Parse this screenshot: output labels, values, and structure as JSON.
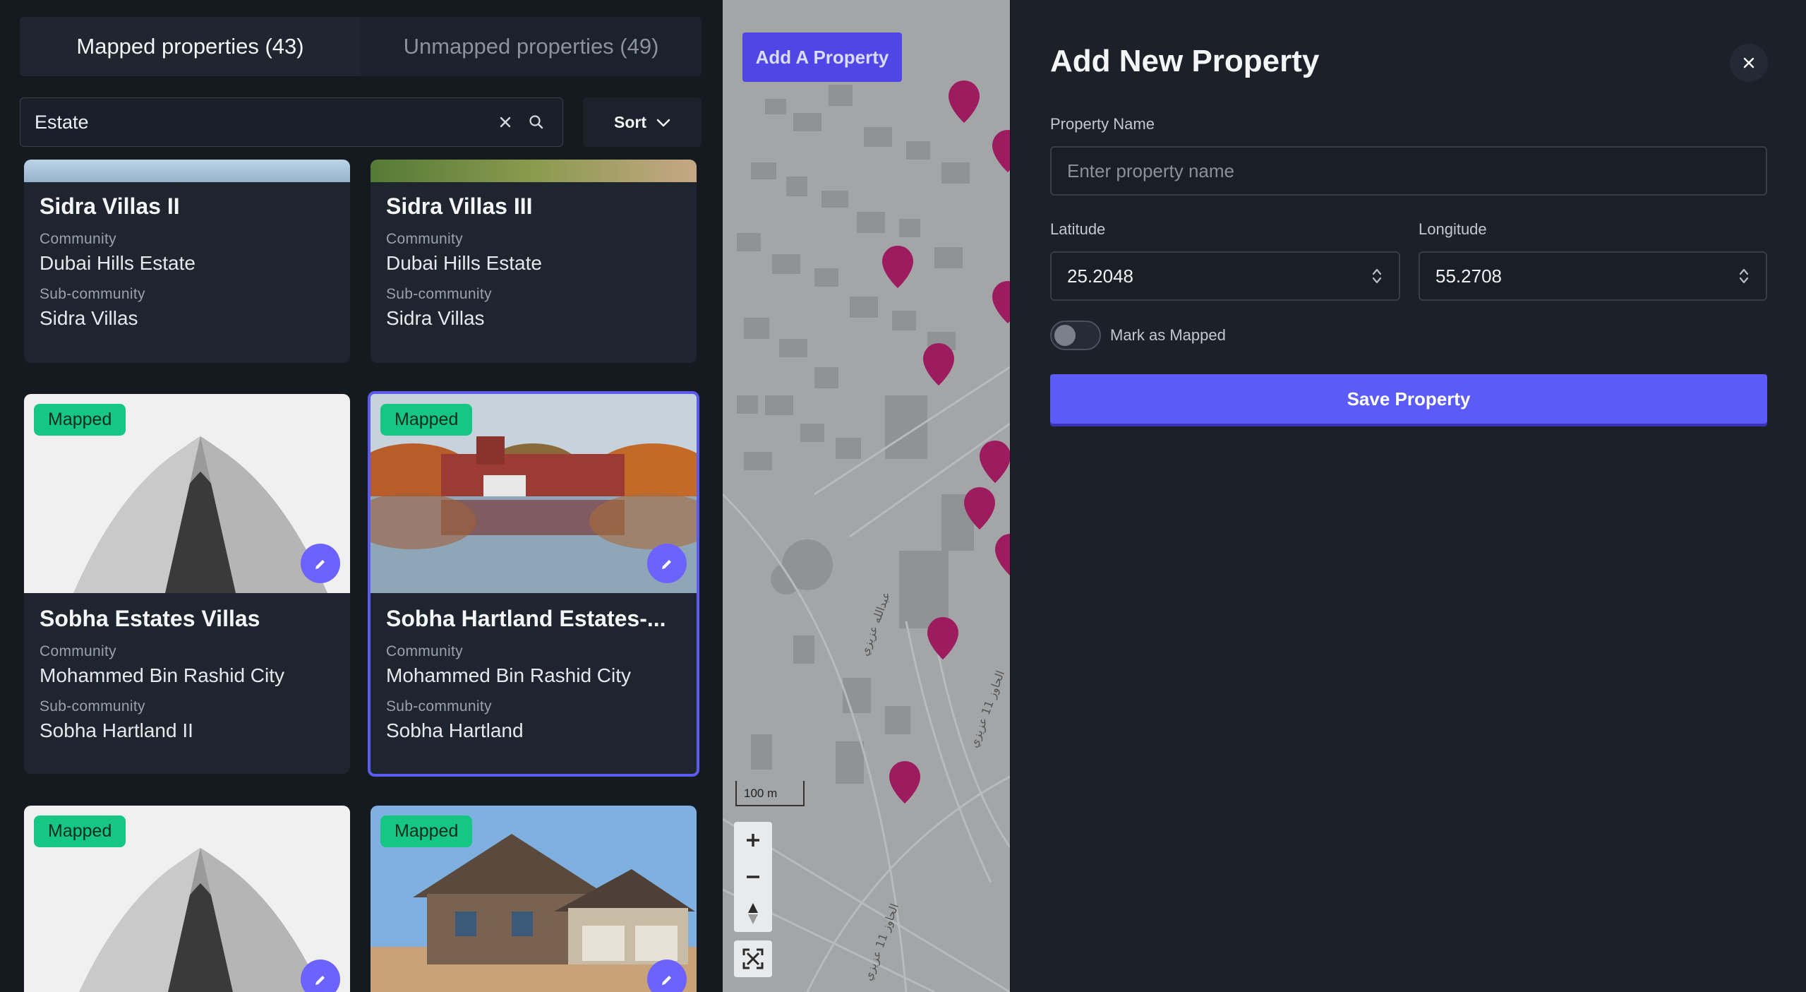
{
  "tabs": {
    "mapped": "Mapped properties (43)",
    "unmapped": "Unmapped properties (49)"
  },
  "search": {
    "value": "Estate"
  },
  "sort": {
    "label": "Sort"
  },
  "labels": {
    "community": "Community",
    "sub_community": "Sub-community",
    "mapped_badge": "Mapped"
  },
  "cards": [
    {
      "title": "Sidra Villas II",
      "community": "Dubai Hills Estate",
      "sub_community": "Sidra Villas"
    },
    {
      "title": "Sidra Villas III",
      "community": "Dubai Hills Estate",
      "sub_community": "Sidra Villas"
    },
    {
      "title": "Sobha Estates Villas",
      "community": "Mohammed Bin Rashid City",
      "sub_community": "Sobha Hartland II"
    },
    {
      "title": "Sobha Hartland Estates-...",
      "community": "Mohammed Bin Rashid City",
      "sub_community": "Sobha Hartland"
    }
  ],
  "map": {
    "add_button": "Add A Property",
    "scale": "100 m",
    "road_labels": [
      "عبدالله عزيزي",
      "الحاوز 11 عزيزي",
      "الحاوز 11 عزيزي"
    ],
    "marker_color": "#9c1c5f"
  },
  "form": {
    "title": "Add New Property",
    "name_label": "Property Name",
    "name_placeholder": "Enter property name",
    "lat_label": "Latitude",
    "lat_value": "25.2048",
    "lng_label": "Longitude",
    "lng_value": "55.2708",
    "toggle_label": "Mark as Mapped",
    "save_label": "Save Property"
  },
  "colors": {
    "accent": "#5b5bf7",
    "mapped": "#16c784"
  }
}
